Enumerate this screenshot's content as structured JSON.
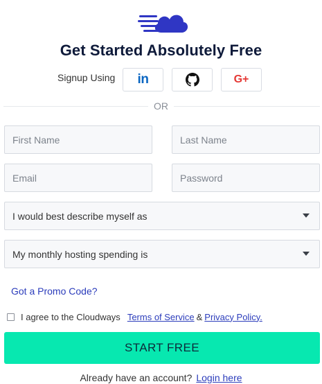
{
  "brand": {
    "logo_icon": "cloud-speed-icon",
    "logo_color": "#2f36c4"
  },
  "header": {
    "title": "Get Started Absolutely Free"
  },
  "signup": {
    "label": "Signup Using",
    "providers": [
      {
        "name": "linkedin",
        "icon": "linkedin-icon",
        "text": "in",
        "color": "#0a66c2"
      },
      {
        "name": "github",
        "icon": "github-icon",
        "color": "#111111"
      },
      {
        "name": "google",
        "icon": "google-plus-icon",
        "text": "G+",
        "color": "#e53935"
      }
    ]
  },
  "divider": {
    "text": "OR"
  },
  "form": {
    "first_name": {
      "placeholder": "First Name",
      "value": ""
    },
    "last_name": {
      "placeholder": "Last Name",
      "value": ""
    },
    "email": {
      "placeholder": "Email",
      "value": ""
    },
    "password": {
      "placeholder": "Password",
      "value": ""
    },
    "describe_select": {
      "selected": "I would best describe myself as"
    },
    "spending_select": {
      "selected": "My monthly hosting spending is"
    },
    "promo_link": "Got a Promo Code?",
    "agree": {
      "checked": false,
      "text": "I agree to the Cloudways",
      "terms": "Terms of Service",
      "ampersand": "&",
      "privacy": "Privacy Policy."
    },
    "submit_label": "START FREE"
  },
  "footer": {
    "text": "Already have an account?",
    "login_link": "Login here"
  },
  "colors": {
    "accent": "#07e8b0",
    "link": "#2b3cbb",
    "title": "#0e1a3a"
  }
}
